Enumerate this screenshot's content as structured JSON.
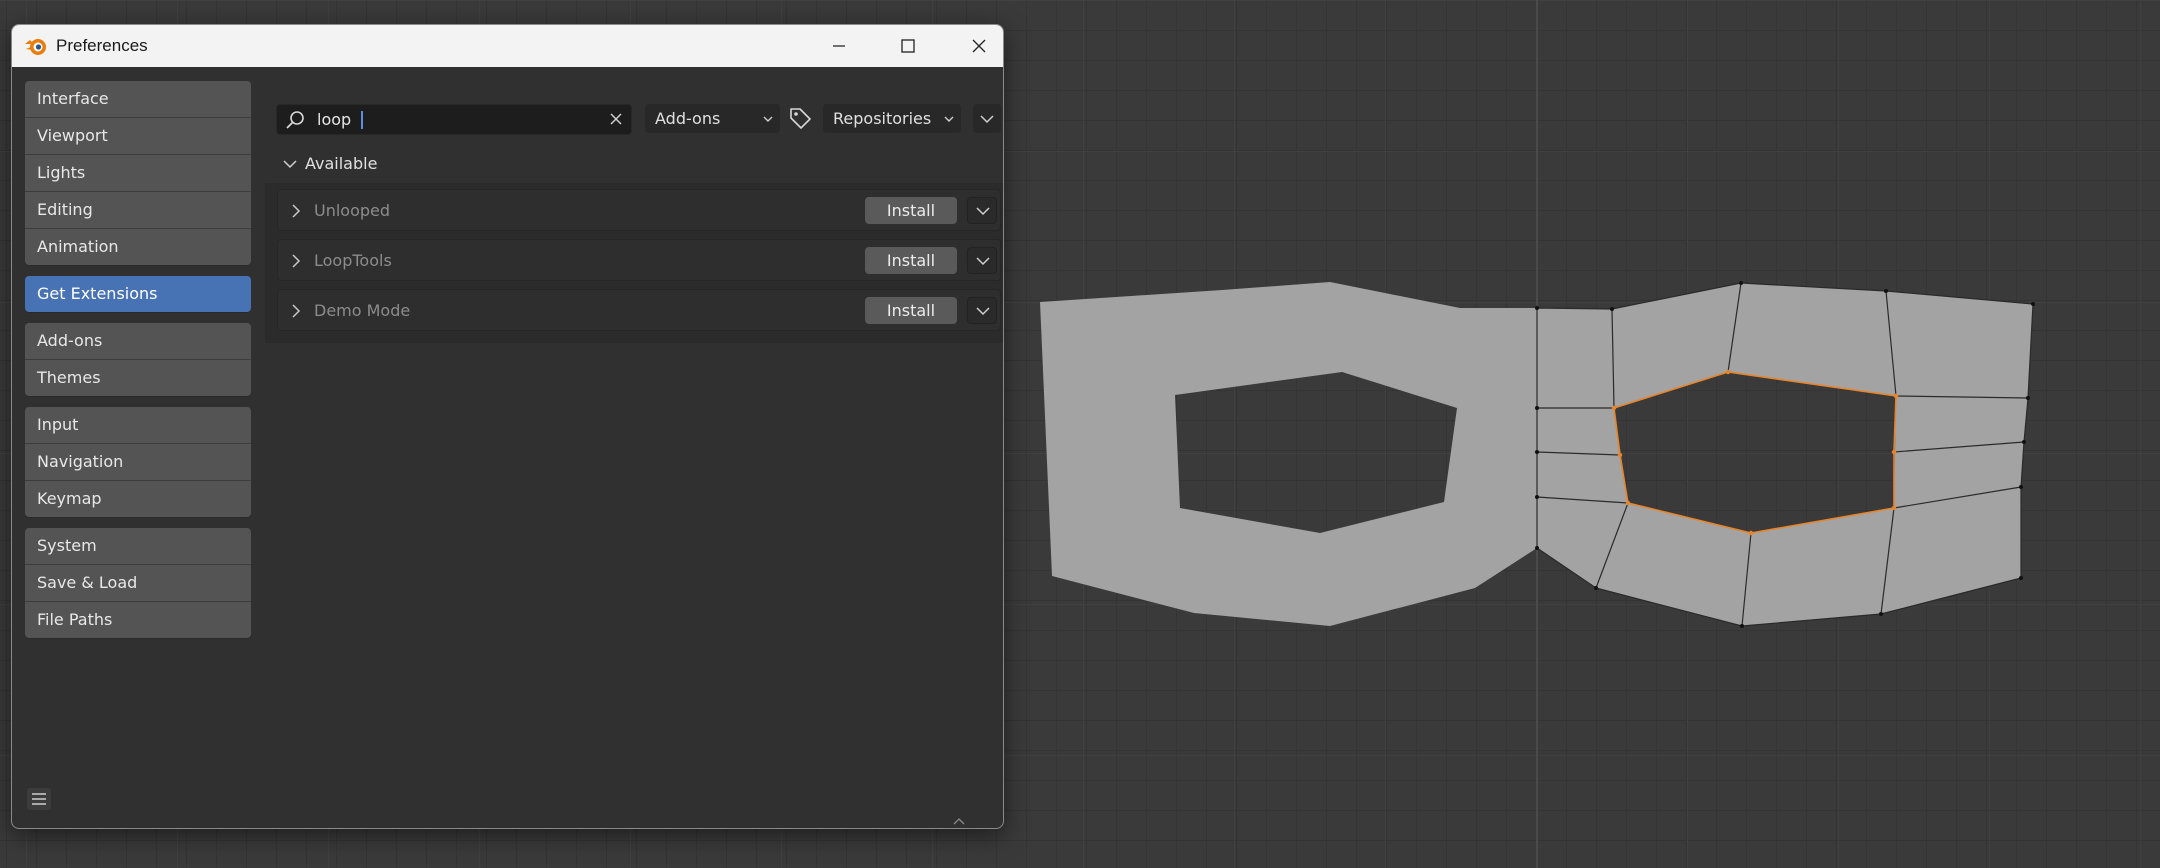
{
  "window": {
    "title": "Preferences",
    "minimize_icon": "minimize-icon",
    "maximize_icon": "maximize-icon",
    "close_icon": "close-icon"
  },
  "sidebar": {
    "groups": [
      {
        "items": [
          {
            "label": "Interface"
          },
          {
            "label": "Viewport"
          },
          {
            "label": "Lights"
          },
          {
            "label": "Editing"
          },
          {
            "label": "Animation"
          }
        ]
      },
      {
        "active": true,
        "items": [
          {
            "label": "Get Extensions"
          }
        ]
      },
      {
        "items": [
          {
            "label": "Add-ons"
          },
          {
            "label": "Themes"
          }
        ]
      },
      {
        "items": [
          {
            "label": "Input"
          },
          {
            "label": "Navigation"
          },
          {
            "label": "Keymap"
          }
        ]
      },
      {
        "items": [
          {
            "label": "System"
          },
          {
            "label": "Save & Load"
          },
          {
            "label": "File Paths"
          }
        ]
      }
    ]
  },
  "toolbar": {
    "search_value": "loop",
    "type_filter": "Add-ons",
    "repo_filter": "Repositories"
  },
  "section": {
    "label": "Available"
  },
  "extensions": [
    {
      "name": "Unlooped",
      "install_label": "Install"
    },
    {
      "name": "LoopTools",
      "install_label": "Install"
    },
    {
      "name": "Demo Mode",
      "install_label": "Install"
    }
  ],
  "colors": {
    "accent": "#4772b3",
    "mesh_fill": "#a3a3a3",
    "selection": "#e8852a"
  }
}
